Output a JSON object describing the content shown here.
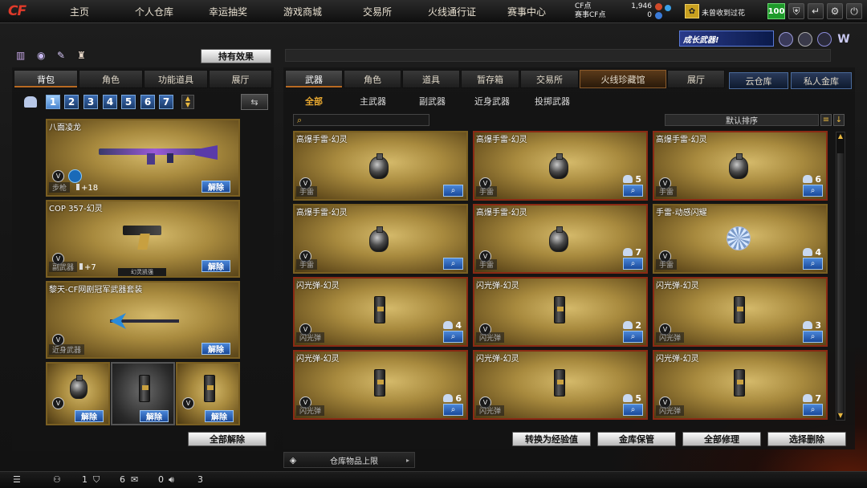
{
  "nav": {
    "tabs": [
      "主页",
      "个人仓库",
      "幸运抽奖",
      "游戏商城",
      "交易所",
      "火线通行证",
      "赛事中心"
    ],
    "active": 1,
    "cf_label": "CF点",
    "cf_value": "1,946",
    "event_cf_label": "赛事CF点",
    "event_cf_value": "0",
    "gift_text": "未曾收到过花",
    "level": "100",
    "colors": {
      "accent": "#b86a22",
      "active_tab": "#6a2a18",
      "level_badge": "#1e9a2a"
    }
  },
  "promo": {
    "text": "成长武器!"
  },
  "left": {
    "effect_button": "持有效果",
    "tabs": [
      "背包",
      "角色",
      "功能道具",
      "展厅"
    ],
    "active_tab": 0,
    "pages": [
      "1",
      "2",
      "3",
      "4",
      "5",
      "6",
      "7"
    ],
    "active_page": 0,
    "slots": [
      {
        "title": "八面凌龙",
        "category": "步枪",
        "bonus": "+18",
        "remove": "解除"
      },
      {
        "title": "COP 357-幻灵",
        "category": "副武器",
        "bonus": "+7",
        "remove": "解除",
        "tag": "幻灵凯强"
      },
      {
        "title": "黎天-CF网剧冠军武器套装",
        "category": "近身武器",
        "remove": "解除"
      }
    ],
    "small_slots": [
      {
        "remove": "解除"
      },
      {
        "remove": "解除"
      },
      {
        "remove": "解除"
      }
    ],
    "remove_all": "全部解除"
  },
  "right": {
    "tabs": [
      "武器",
      "角色",
      "道具",
      "暂存箱",
      "交易所",
      "火线珍藏馆",
      "展厅"
    ],
    "active_tab": 0,
    "side_tabs": [
      "云仓库",
      "私人金库"
    ],
    "subtabs": [
      "全部",
      "主武器",
      "副武器",
      "近身武器",
      "投掷武器"
    ],
    "active_subtab": 0,
    "search_placeholder": "",
    "sort_label": "默认排序",
    "items": [
      {
        "title": "高爆手雷-幻灵",
        "category": "手雷",
        "count": "",
        "kind": "grenade"
      },
      {
        "title": "高爆手雷-幻灵",
        "category": "手雷",
        "count": "5",
        "kind": "grenade"
      },
      {
        "title": "高爆手雷-幻灵",
        "category": "手雷",
        "count": "6",
        "kind": "grenade"
      },
      {
        "title": "高爆手雷-幻灵",
        "category": "手雷",
        "count": "",
        "kind": "grenade"
      },
      {
        "title": "高爆手雷-幻灵",
        "category": "手雷",
        "count": "7",
        "kind": "grenade"
      },
      {
        "title": "手雷-动感闪耀",
        "category": "手雷",
        "count": "4",
        "kind": "disco"
      },
      {
        "title": "闪光弹-幻灵",
        "category": "闪光弹",
        "count": "4",
        "kind": "flash"
      },
      {
        "title": "闪光弹-幻灵",
        "category": "闪光弹",
        "count": "2",
        "kind": "flash"
      },
      {
        "title": "闪光弹-幻灵",
        "category": "闪光弹",
        "count": "3",
        "kind": "flash"
      },
      {
        "title": "闪光弹-幻灵",
        "category": "闪光弹",
        "count": "6",
        "kind": "flash"
      },
      {
        "title": "闪光弹-幻灵",
        "category": "闪光弹",
        "count": "5",
        "kind": "flash"
      },
      {
        "title": "闪光弹-幻灵",
        "category": "闪光弹",
        "count": "7",
        "kind": "flash"
      }
    ],
    "actions": [
      "转换为经验值",
      "金库保管",
      "全部修理",
      "选择删除"
    ],
    "limit_label": "仓库物品上限"
  },
  "bottom": {
    "values": [
      "1",
      "6",
      "0",
      "3"
    ]
  }
}
